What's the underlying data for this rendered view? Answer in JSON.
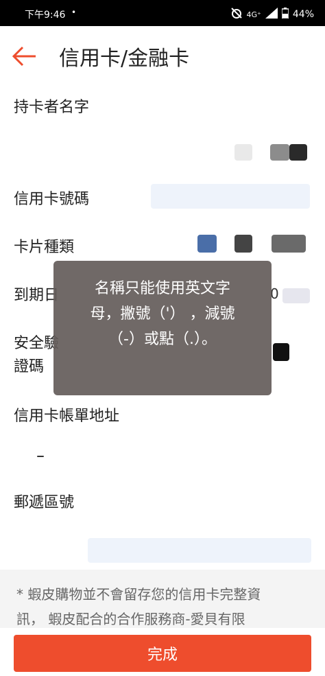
{
  "status_bar": {
    "time": "下午9:46",
    "dot": "•",
    "network": "4G⁺",
    "battery": "44%"
  },
  "header": {
    "title": "信用卡/金融卡",
    "back_icon": "arrow-left-icon"
  },
  "form": {
    "cardholder_label": "持卡者名字",
    "card_number_label": "信用卡號碼",
    "card_type_label": "卡片種類",
    "expiry_label": "到期日",
    "cvv_label_line1": "安全驗",
    "cvv_label_line2": "證碼",
    "billing_address_label": "信用卡帳單地址",
    "zip_label": "郵遞區號",
    "expiry_value_tail": "0"
  },
  "toast": {
    "line1": "名稱只能使用英文字",
    "line2": "母，撇號（'）  ，減號",
    "line3": "（-）或點（.）。"
  },
  "notice": {
    "line1": "* 蝦皮購物並不會留存您的信用卡完整資",
    "line2": "訊， 蝦皮配合的合作服務商-愛貝有限"
  },
  "footer": {
    "done_label": "完成"
  },
  "colors": {
    "accent": "#ee4d2d",
    "toast_bg": "#645c5a"
  }
}
